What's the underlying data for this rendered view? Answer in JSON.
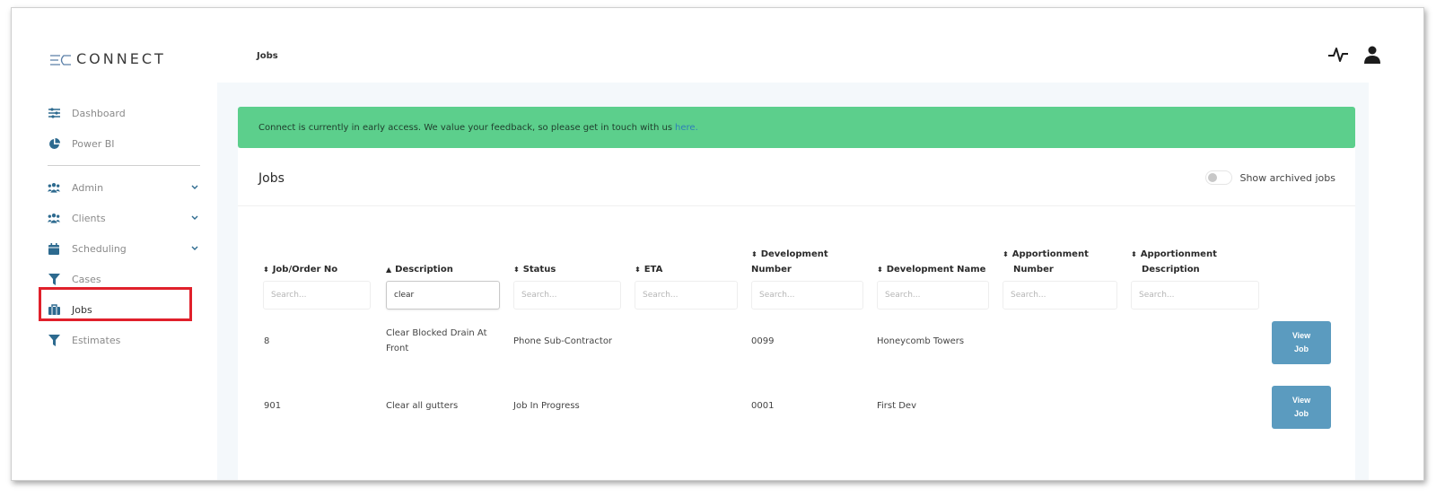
{
  "app": {
    "logo_text": "CONNECT"
  },
  "sidebar": {
    "items": [
      {
        "label": "Dashboard",
        "icon": "sliders-icon"
      },
      {
        "label": "Power BI",
        "icon": "pie-chart-icon"
      },
      {
        "label": "Admin",
        "icon": "users-icon",
        "expandable": true
      },
      {
        "label": "Clients",
        "icon": "users-icon",
        "expandable": true
      },
      {
        "label": "Scheduling",
        "icon": "calendar-icon",
        "expandable": true
      },
      {
        "label": "Cases",
        "icon": "filter-icon"
      },
      {
        "label": "Jobs",
        "icon": "briefcase-icon",
        "active": true
      },
      {
        "label": "Estimates",
        "icon": "filter-icon"
      }
    ]
  },
  "header": {
    "title": "Jobs"
  },
  "banner": {
    "text": "Connect is currently in early access. We value your feedback, so please get in touch with us",
    "link": "here."
  },
  "card": {
    "title": "Jobs",
    "toggle_label": "Show archived jobs",
    "toggle_on": false
  },
  "table": {
    "columns": [
      {
        "label1": "",
        "label2": "Job/Order No",
        "sort": "⬍",
        "search": "Search..."
      },
      {
        "label1": "",
        "label2": "Description",
        "sort": "▲",
        "search": "clear"
      },
      {
        "label1": "",
        "label2": "Status",
        "sort": "⬍",
        "search": "Search..."
      },
      {
        "label1": "",
        "label2": "ETA",
        "sort": "⬍",
        "search": "Search..."
      },
      {
        "label1": "Development",
        "label2": "Number",
        "sort": "⬍",
        "search": "Search..."
      },
      {
        "label1": "",
        "label2": "Development Name",
        "sort": "⬍",
        "search": "Search..."
      },
      {
        "label1": "Apportionment",
        "label2": "Number",
        "sort": "⬍",
        "search": "Search..."
      },
      {
        "label1": "Apportionment",
        "label2": "Description",
        "sort": "⬍",
        "search": "Search..."
      }
    ],
    "rows": [
      {
        "job_no": "8",
        "description_1": "Clear Blocked Drain At",
        "description_2": "Front",
        "status": "Phone Sub-Contractor",
        "eta": "",
        "dev_number": "0099",
        "dev_name": "Honeycomb Towers",
        "app_number": "",
        "app_desc": "",
        "btn_1": "View",
        "btn_2": "Job"
      },
      {
        "job_no": "901",
        "description_1": "Clear all gutters",
        "description_2": "",
        "status": "Job In Progress",
        "eta": "",
        "dev_number": "0001",
        "dev_name": "First Dev",
        "app_number": "",
        "app_desc": "",
        "btn_1": "View",
        "btn_2": "Job"
      }
    ]
  },
  "colors": {
    "accent": "#2d6a8f",
    "banner": "#5ccf8c",
    "button": "#5b9bbf",
    "highlight": "#e0202b"
  }
}
